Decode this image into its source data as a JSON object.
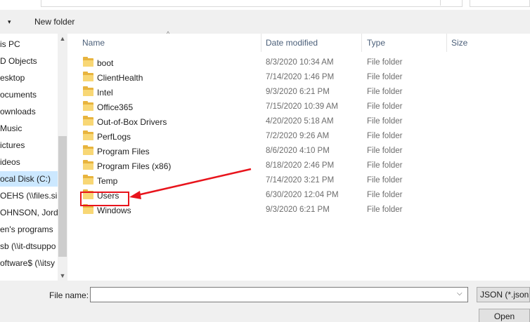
{
  "toolbar": {
    "organize_arrow": "▾",
    "new_folder_label": "New folder"
  },
  "nav": {
    "items": [
      {
        "label": "is PC"
      },
      {
        "label": "D Objects"
      },
      {
        "label": "esktop"
      },
      {
        "label": "ocuments"
      },
      {
        "label": "ownloads"
      },
      {
        "label": "Music"
      },
      {
        "label": "ictures"
      },
      {
        "label": "ideos"
      },
      {
        "label": "ocal Disk (C:)",
        "selected": true
      },
      {
        "label": "OEHS (\\\\files.si"
      },
      {
        "label": "OHNSON, Jorda"
      },
      {
        "label": "en's programs"
      },
      {
        "label": "sb (\\\\it-dtsuppo"
      },
      {
        "label": "oftware$ (\\\\itsy"
      }
    ]
  },
  "columns": {
    "name": "Name",
    "date": "Date modified",
    "type": "Type",
    "size": "Size"
  },
  "files": [
    {
      "name": "boot",
      "date": "8/3/2020 10:34 AM",
      "type": "File folder"
    },
    {
      "name": "ClientHealth",
      "date": "7/14/2020 1:46 PM",
      "type": "File folder"
    },
    {
      "name": "Intel",
      "date": "9/3/2020 6:21 PM",
      "type": "File folder"
    },
    {
      "name": "Office365",
      "date": "7/15/2020 10:39 AM",
      "type": "File folder"
    },
    {
      "name": "Out-of-Box Drivers",
      "date": "4/20/2020 5:18 AM",
      "type": "File folder"
    },
    {
      "name": "PerfLogs",
      "date": "7/2/2020 9:26 AM",
      "type": "File folder"
    },
    {
      "name": "Program Files",
      "date": "8/6/2020 4:10 PM",
      "type": "File folder"
    },
    {
      "name": "Program Files (x86)",
      "date": "8/18/2020 2:46 PM",
      "type": "File folder"
    },
    {
      "name": "Temp",
      "date": "7/14/2020 3:21 PM",
      "type": "File folder"
    },
    {
      "name": "Users",
      "date": "6/30/2020 12:04 PM",
      "type": "File folder",
      "highlighted": true
    },
    {
      "name": "Windows",
      "date": "9/3/2020 6:21 PM",
      "type": "File folder"
    }
  ],
  "bottom": {
    "file_name_label": "File name:",
    "file_name_value": "",
    "filter_label": "JSON (*.json;*",
    "open_label": "Open"
  },
  "annotation": {
    "color": "#e8141c"
  },
  "colors": {
    "selection": "#cce8ff",
    "folder": "#f8d775",
    "header_text": "#4c607a"
  }
}
